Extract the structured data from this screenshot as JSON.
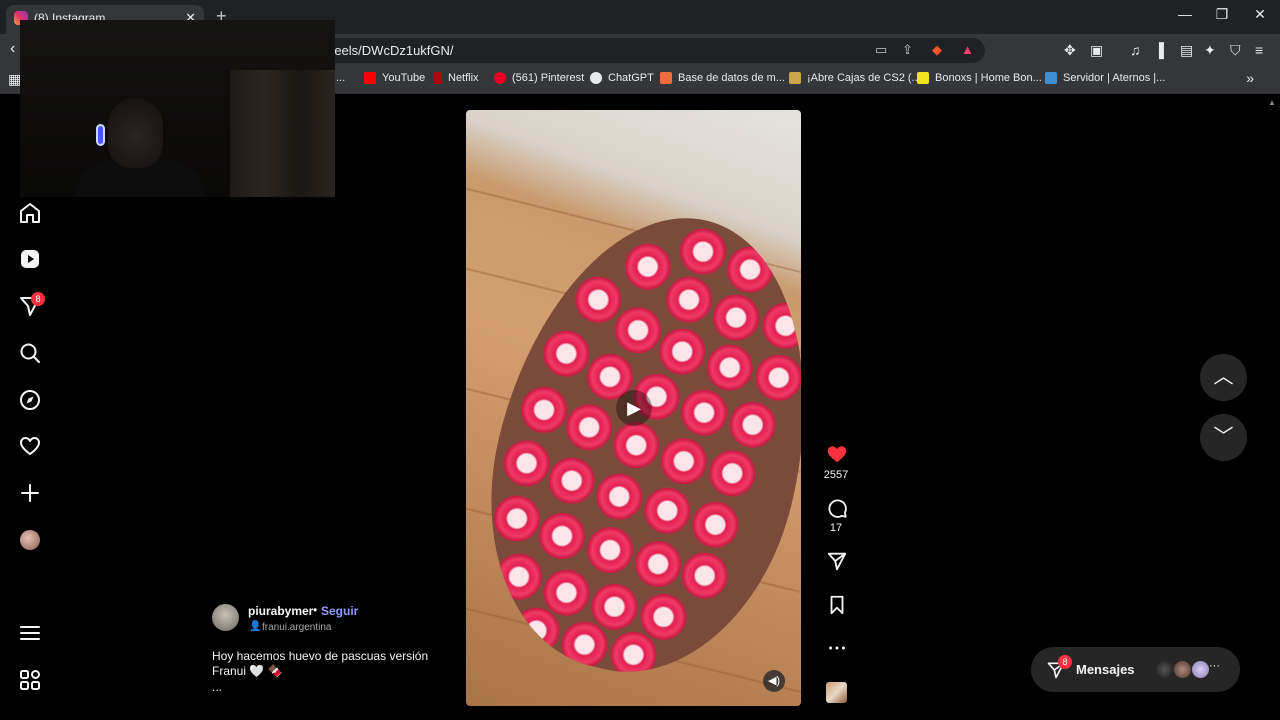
{
  "browser": {
    "tab_title": "(8) Instagram",
    "tab_close": "✕",
    "new_tab": "+",
    "url": "reels/DWcDz1ukfGN/",
    "window": {
      "minimize": "—",
      "restore": "❐",
      "close": "✕"
    }
  },
  "bookmarks": [
    {
      "label": "...",
      "color": "#4a4a4a"
    },
    {
      "label": "YouTube",
      "color": "#ff0000"
    },
    {
      "label": "Netflix",
      "color": "#b1060f"
    },
    {
      "label": "(561) Pinterest",
      "color": "#e60023"
    },
    {
      "label": "ChatGPT",
      "color": "#e8eaed"
    },
    {
      "label": "Base de datos de m...",
      "color": "#ef6c3c"
    },
    {
      "label": "¡Abre Cajas de CS2 (...",
      "color": "#c9a44a"
    },
    {
      "label": "Bonoxs | Home Bon...",
      "color": "#f2e01f"
    },
    {
      "label": "Servidor | Aternos |...",
      "color": "#3e8ed0"
    }
  ],
  "sidebar": {
    "notifications_count": "8"
  },
  "reel": {
    "likes": "2557",
    "comments": "17",
    "author": "piurabymer",
    "separator": "•",
    "follow_label": "Seguir",
    "collaborator": "franui.argentina",
    "caption_line1": "Hoy hacemos huevo de pascuas versión",
    "caption_line2": "Franui 🤍 🍫",
    "caption_more": "..."
  },
  "messages": {
    "label": "Mensajes",
    "badge": "8",
    "more": "···"
  },
  "colors": {
    "like_red": "#ff3040",
    "link_blue": "#8e9cff",
    "background": "#000000"
  }
}
